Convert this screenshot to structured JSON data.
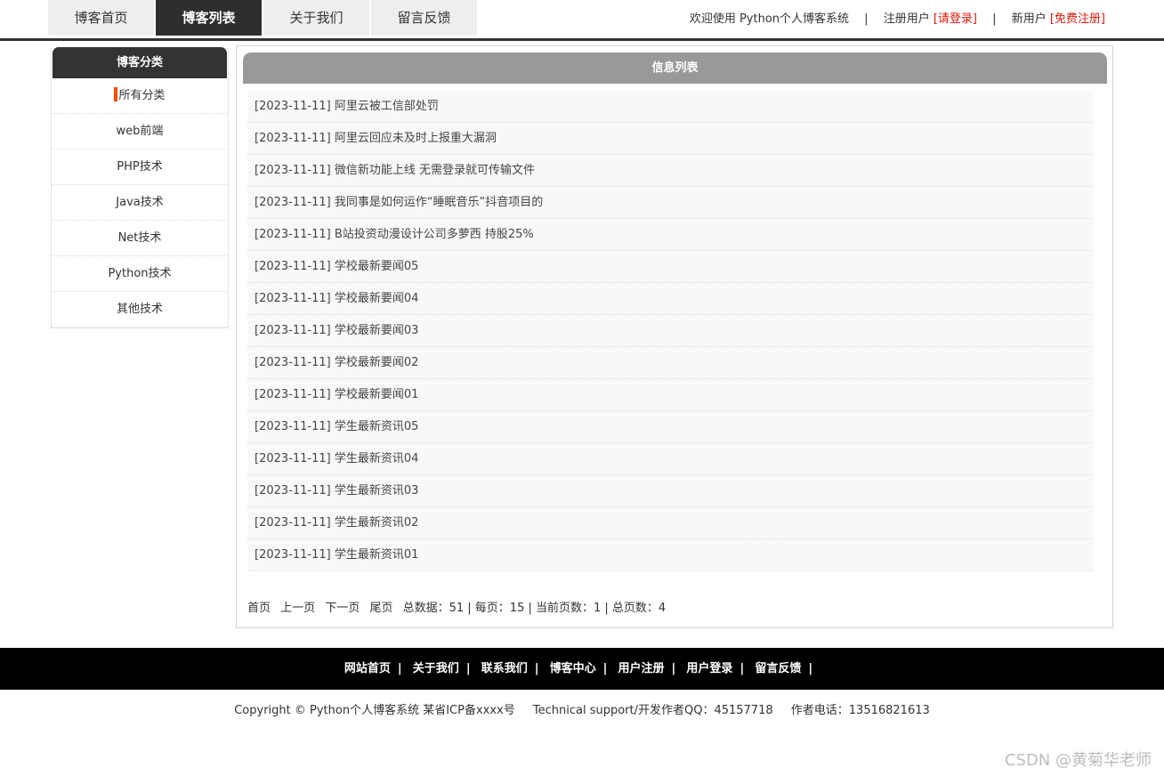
{
  "nav": {
    "tabs": [
      {
        "label": "博客首页",
        "active": false
      },
      {
        "label": "博客列表",
        "active": true
      },
      {
        "label": "关于我们",
        "active": false
      },
      {
        "label": "留言反馈",
        "active": false
      }
    ]
  },
  "top_right": {
    "welcome": "欢迎使用 Python个人博客系统",
    "separator": "|",
    "registered_label": "注册用户",
    "login_link": "[请登录]",
    "new_user_label": "新用户",
    "register_link": "[免费注册]"
  },
  "sidebar": {
    "title": "博客分类",
    "items": [
      "所有分类",
      "web前端",
      "PHP技术",
      "Java技术",
      "Net技术",
      "Python技术",
      "其他技术"
    ]
  },
  "main": {
    "title": "信息列表",
    "items": [
      "[2023-11-11] 阿里云被工信部处罚",
      "[2023-11-11] 阿里云回应未及时上报重大漏洞",
      "[2023-11-11] 微信新功能上线 无需登录就可传输文件",
      "[2023-11-11] 我同事是如何运作“睡眠音乐”抖音项目的",
      "[2023-11-11] B站投资动漫设计公司多萝西 持股25%",
      "[2023-11-11] 学校最新要闻05",
      "[2023-11-11] 学校最新要闻04",
      "[2023-11-11] 学校最新要闻03",
      "[2023-11-11] 学校最新要闻02",
      "[2023-11-11] 学校最新要闻01",
      "[2023-11-11] 学生最新资讯05",
      "[2023-11-11] 学生最新资讯04",
      "[2023-11-11] 学生最新资讯03",
      "[2023-11-11] 学生最新资讯02",
      "[2023-11-11] 学生最新资讯01"
    ]
  },
  "pager": {
    "first": "首页",
    "prev": "上一页",
    "next": "下一页",
    "last": "尾页",
    "summary": "总数据：51 | 每页：15 | 当前页数：1 | 总页数：4"
  },
  "footer": {
    "links": [
      "网站首页",
      "关于我们",
      "联系我们",
      "博客中心",
      "用户注册",
      "用户登录",
      "留言反馈"
    ],
    "separator": "|",
    "copyright": "Copyright © Python个人博客系统 某省ICP备xxxx号",
    "support": "Technical support/开发作者QQ：45157718",
    "phone": "作者电话：13516821613"
  },
  "watermark": "CSDN @黄菊华老师"
}
